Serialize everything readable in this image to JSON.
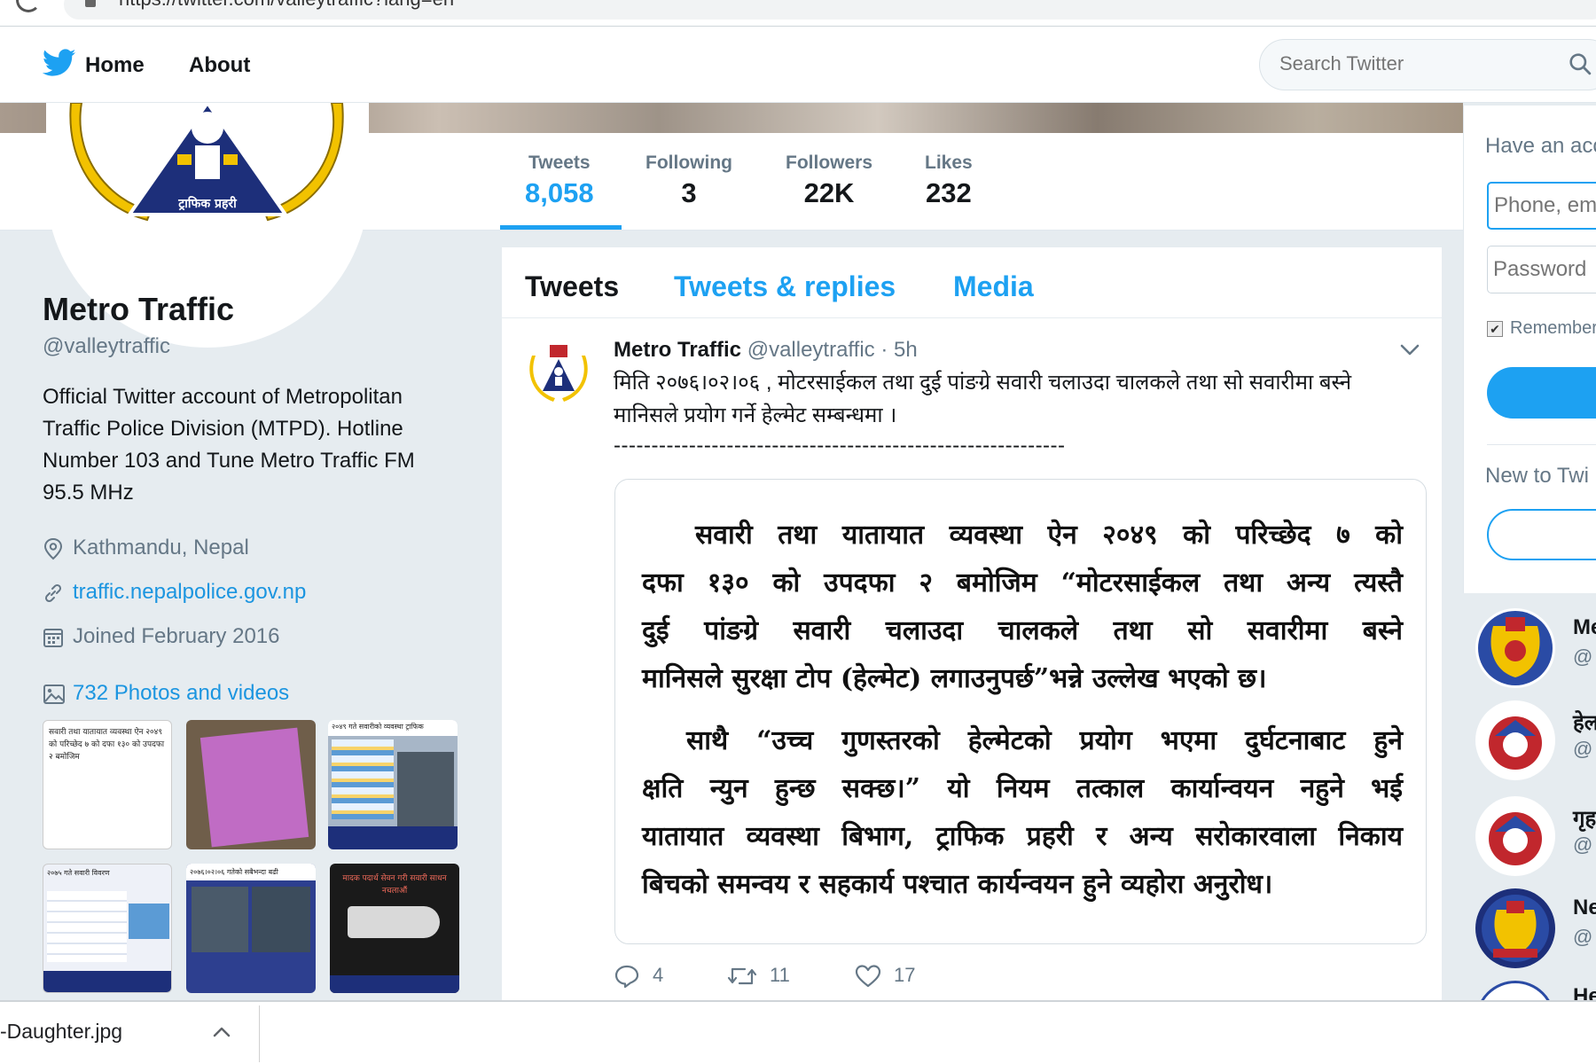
{
  "browser": {
    "url": "https://twitter.com/valleytraffic?lang=en"
  },
  "nav": {
    "home": "Home",
    "about": "About",
    "search_placeholder": "Search Twitter"
  },
  "stats": [
    {
      "label": "Tweets",
      "value": "8,058"
    },
    {
      "label": "Following",
      "value": "3"
    },
    {
      "label": "Followers",
      "value": "22K"
    },
    {
      "label": "Likes",
      "value": "232"
    }
  ],
  "profile": {
    "name": "Metro Traffic",
    "handle": "@valleytraffic",
    "bio": "Official Twitter account of Metropolitan Traffic Police Division (MTPD). Hotline Number 103 and Tune Metro Traffic FM 95.5 MHz",
    "location": "Kathmandu, Nepal",
    "website": "traffic.nepalpolice.gov.np",
    "joined": "Joined February 2016",
    "photos_link": "732 Photos and videos",
    "avatar_text": "ट्राफिक प्रहरी"
  },
  "thumbs": [
    {
      "text": "सवारी तथा यातायात व्यवस्था ऐन २०४९ को परिच्छेद ७ को दफा १३० को उपदफा २ बमोजिम",
      "bg": "#ffffff"
    },
    {
      "text": "",
      "bg": "#c06cc4"
    },
    {
      "text": "२०४९ गते सवारीको व्यवस्था ट्राफिक",
      "bg": "#5b7fbf"
    },
    {
      "text": "२०७५ गते सवारी विवरण",
      "bg": "#eef1f8"
    },
    {
      "text": "२०७६।०२।०६ गतेको सबैभन्दा बढी",
      "bg": "#2d3f8f"
    },
    {
      "text": "मादक पदार्थ सेवन गरी सवारी साधन नचलाऔं",
      "bg": "#1a1a1a"
    }
  ],
  "timeline": {
    "tabs": [
      "Tweets",
      "Tweets & replies",
      "Media"
    ],
    "tweet": {
      "name": "Metro Traffic",
      "handle": "@valleytraffic",
      "time": "· 5h",
      "text": "मिति २०७६।०२।०६ , मोटरसाईकल तथा दुई पांङग्रे सवारी चलाउदा चालकले तथा सो सवारीमा बस्ने मानिसले प्रयोग गर्ने हेल्मेट सम्बन्धमा ।",
      "dashes": "------------------------------------------------------------",
      "media_para1": [
        "सवारी तथा यातायात व्यवस्था ऐन २०४९ को परिच्छेद ७ को",
        "दफा १३० को उपदफा २ बमोजिम “मोटरसाईकल तथा अन्य त्यस्तै",
        "दुई पांङग्रे सवारी चलाउदा चालकले तथा सो सवारीमा बस्ने",
        "मानिसले सुरक्षा टोप (हेल्मेट) लगाउनुपर्छ”भन्ने उल्लेख भएको छ।"
      ],
      "media_para2": [
        "साथै “उच्च गुणस्तरको हेल्मेटको प्रयोग भएमा दुर्घटनाबाट हुने",
        "क्षति न्युन हुन्छ सक्छ।” यो नियम तत्काल कार्यान्वयन नहुने भई",
        "यातायात व्यवस्था बिभाग, ट्राफिक प्रहरी र अन्य सरोकारवाला निकाय",
        "बिचको समन्वय र सहकार्य पश्चात कार्यन्वयन हुने व्यहोरा अनुरोध।"
      ],
      "replies": "4",
      "retweets": "11",
      "likes": "17"
    }
  },
  "login": {
    "title": "Have an acc",
    "phone_placeholder": "Phone, em",
    "password_placeholder": "Password",
    "remember": "Remember",
    "new_to": "New to Twi"
  },
  "suggestions": [
    {
      "name": "Me",
      "handle": "@"
    },
    {
      "name": "हेल",
      "handle": "@"
    },
    {
      "name": "गृह",
      "handle": "@"
    },
    {
      "name": "Ne",
      "handle": "@"
    },
    {
      "name": "He",
      "handle": ""
    }
  ],
  "download": {
    "filename": "-Daughter.jpg"
  },
  "colors": {
    "accent": "#1da1f2",
    "link": "#1b95e0",
    "muted": "#657786",
    "page_bg": "#e6ecf0"
  }
}
